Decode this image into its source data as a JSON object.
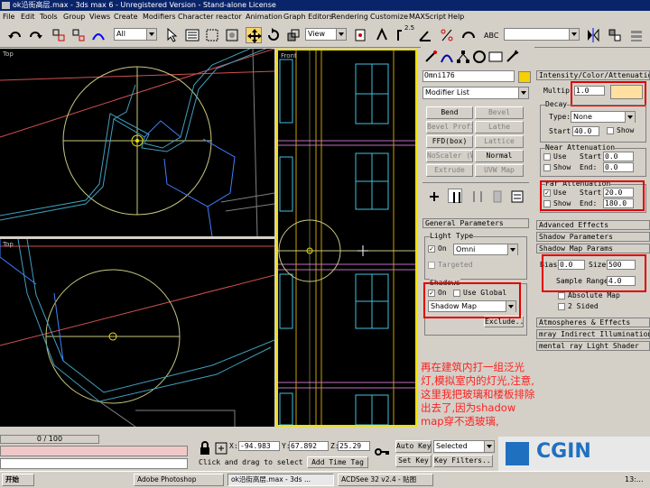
{
  "titlebar": {
    "title": "ok沿街高层.max - 3ds max 6 - Unregistered Version - Stand-alone License"
  },
  "menu": [
    "File",
    "Edit",
    "Tools",
    "Group",
    "Views",
    "Create",
    "Modifiers",
    "Character",
    "reactor",
    "Animation",
    "Graph Editors",
    "Rendering",
    "Customize",
    "MAXScript",
    "Help"
  ],
  "toolbar": {
    "selection_filter": "All",
    "ref_coord": "View",
    "snap_value": "2.5"
  },
  "viewports": {
    "top1": "Top",
    "front": "Front",
    "top2": "Top"
  },
  "command_panel": {
    "object_name": "Omni176",
    "name_color": "#f8d000",
    "modifier_list": "Modifier List",
    "buttons": [
      "Bend",
      "Bevel",
      "Bevel Profile",
      "Lathe",
      "FFD(box)",
      "Lattice",
      "NoScaler (W)",
      "Normal",
      "Extrude",
      "UVW Map"
    ],
    "general_params": "General Parameters",
    "light_type_label": "Light Type",
    "light_on": "On",
    "light_type": "Omni",
    "targeted": "Targeted",
    "shadows_label": "Shadows",
    "shadows_on": "On",
    "use_global": "Use Global",
    "shadow_type": "Shadow Map",
    "exclude": "Exclude..."
  },
  "intensity_panel": {
    "header": "Intensity/Color/Attenuation",
    "multiplier_label": "Multip:",
    "multiplier": "1.0",
    "light_color": "#ffe0a0",
    "decay_label": "Decay",
    "type_label": "Type:",
    "decay_type": "None",
    "start_label": "Start:",
    "decay_start": "40.0",
    "show": "Show",
    "near_atten": "Near Attenuation",
    "use": "Use",
    "near_start": "0.0",
    "near_end": "0.0",
    "end_label": "End:",
    "far_atten": "Far Attenuation",
    "far_start": "20.0",
    "far_end": "180.0"
  },
  "rollouts": {
    "advanced": "Advanced Effects",
    "shadow_params": "Shadow Parameters",
    "shadow_map": "Shadow Map Params",
    "atmospheres": "Atmospheres & Effects",
    "indirect": "mray Indirect Illumination",
    "mental": "mental ray Light Shader"
  },
  "shadow_map": {
    "bias_label": "Bias:",
    "bias": "0.0",
    "size_label": "Size:",
    "size": "500",
    "range_label": "Sample Range:",
    "range": "4.0",
    "absolute": "Absolute Map",
    "two_sided": "2 Sided"
  },
  "annotation": "再在建筑内打一组泛光灯,模拟室内的灯光,注意,这里我把玻璃和楼板排除出去了,因为shadow map穿不透玻璃,",
  "status": {
    "frame": "0 / 100",
    "x_label": "X:",
    "x": "-94.983",
    "y_label": "Y:",
    "y": "67.892",
    "z_label": "Z:",
    "z": "25.29",
    "prompt": "Click and drag to select",
    "add_time_tag": "Add Time Tag",
    "auto_key": "Auto Key",
    "set_key": "Set Key",
    "selected": "Selected",
    "key_filters": "Key Filters..."
  },
  "taskbar": {
    "start": "开始",
    "tasks": [
      "Adobe Photoshop",
      "ok沿街高层.max - 3ds ...",
      "ACDSee 32 v2.4 - 贴图"
    ],
    "clock": "13:..."
  },
  "watermark": "CGIN"
}
